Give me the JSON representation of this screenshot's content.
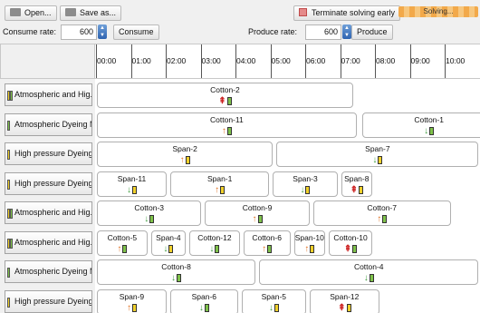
{
  "toolbar": {
    "open_label": "Open...",
    "save_label": "Save as...",
    "terminate_label": "Terminate solving early",
    "solving_label": "Solving..."
  },
  "rates": {
    "consume_label": "Consume rate:",
    "consume_value": "600",
    "consume_button": "Consume",
    "produce_label": "Produce rate:",
    "produce_value": "600",
    "produce_button": "Produce"
  },
  "timeline": {
    "ticks": [
      "00:00",
      "01:00",
      "02:00",
      "03:00",
      "04:00",
      "05:00",
      "06:00",
      "07:00",
      "08:00",
      "09:00",
      "10:00"
    ]
  },
  "colors": {
    "green": "#7fc24a",
    "yellow": "#f0d02a",
    "arrow_up": "#e07020",
    "arrow_down": "#3a9a3a",
    "arrow_double": "#cc2020"
  },
  "rows": [
    {
      "label": "Atmospheric and Hig...",
      "swatches": [
        "yellow",
        "green"
      ],
      "tasks": [
        {
          "name": "Cotton-2",
          "start": 0,
          "end": 7.4,
          "arrow": "double",
          "battery": "green"
        }
      ]
    },
    {
      "label": "Atmospheric Dyeing M...",
      "swatches": [
        "green"
      ],
      "tasks": [
        {
          "name": "Cotton-11",
          "start": 0,
          "end": 7.5,
          "arrow": "up",
          "battery": "green"
        },
        {
          "name": "Cotton-1",
          "start": 7.6,
          "end": 11.5,
          "arrow": "down",
          "battery": "green"
        }
      ]
    },
    {
      "label": "High pressure Dyeing ...",
      "swatches": [
        "yellow"
      ],
      "tasks": [
        {
          "name": "Span-2",
          "start": 0,
          "end": 5.1,
          "arrow": "up",
          "battery": "yellow"
        },
        {
          "name": "Span-7",
          "start": 5.15,
          "end": 11.0,
          "arrow": "down",
          "battery": "yellow"
        }
      ]
    },
    {
      "label": "High pressure Dyeing ...",
      "swatches": [
        "yellow"
      ],
      "tasks": [
        {
          "name": "Span-11",
          "start": 0,
          "end": 2.05,
          "arrow": "down",
          "battery": "yellow"
        },
        {
          "name": "Span-1",
          "start": 2.1,
          "end": 5.0,
          "arrow": "up",
          "battery": "yellow"
        },
        {
          "name": "Span-3",
          "start": 5.05,
          "end": 6.95,
          "arrow": "down",
          "battery": "yellow"
        },
        {
          "name": "Span-8",
          "start": 7.0,
          "end": 7.95,
          "arrow": "double",
          "battery": "yellow"
        }
      ]
    },
    {
      "label": "Atmospheric and Hig...",
      "swatches": [
        "yellow",
        "green"
      ],
      "tasks": [
        {
          "name": "Cotton-3",
          "start": 0,
          "end": 3.05,
          "arrow": "down",
          "battery": "green"
        },
        {
          "name": "Cotton-9",
          "start": 3.1,
          "end": 6.15,
          "arrow": "up",
          "battery": "green"
        },
        {
          "name": "Cotton-7",
          "start": 6.2,
          "end": 10.2,
          "arrow": "up",
          "battery": "green"
        }
      ]
    },
    {
      "label": "Atmospheric and Hig...",
      "swatches": [
        "yellow",
        "green"
      ],
      "tasks": [
        {
          "name": "Cotton-5",
          "start": 0,
          "end": 1.5,
          "arrow": "up",
          "battery": "green"
        },
        {
          "name": "Span-4",
          "start": 1.55,
          "end": 2.6,
          "arrow": "down",
          "battery": "yellow"
        },
        {
          "name": "Cotton-12",
          "start": 2.65,
          "end": 4.15,
          "arrow": "down",
          "battery": "green"
        },
        {
          "name": "Cotton-6",
          "start": 4.2,
          "end": 5.6,
          "arrow": "up",
          "battery": "green"
        },
        {
          "name": "Span-10",
          "start": 5.65,
          "end": 6.6,
          "arrow": "up",
          "battery": "yellow"
        },
        {
          "name": "Cotton-10",
          "start": 6.65,
          "end": 7.95,
          "arrow": "double",
          "battery": "green"
        }
      ]
    },
    {
      "label": "Atmospheric Dyeing M...",
      "swatches": [
        "green"
      ],
      "tasks": [
        {
          "name": "Cotton-8",
          "start": 0,
          "end": 4.6,
          "arrow": "down",
          "battery": "green"
        },
        {
          "name": "Cotton-4",
          "start": 4.65,
          "end": 11.0,
          "arrow": "down",
          "battery": "green"
        }
      ]
    },
    {
      "label": "High pressure Dyeing ...",
      "swatches": [
        "yellow"
      ],
      "tasks": [
        {
          "name": "Span-9",
          "start": 0,
          "end": 2.05,
          "arrow": "up",
          "battery": "yellow"
        },
        {
          "name": "Span-6",
          "start": 2.1,
          "end": 4.1,
          "arrow": "down",
          "battery": "green"
        },
        {
          "name": "Span-5",
          "start": 4.15,
          "end": 6.05,
          "arrow": "down",
          "battery": "yellow"
        },
        {
          "name": "Span-12",
          "start": 6.1,
          "end": 8.15,
          "arrow": "double",
          "battery": "yellow"
        }
      ]
    }
  ]
}
